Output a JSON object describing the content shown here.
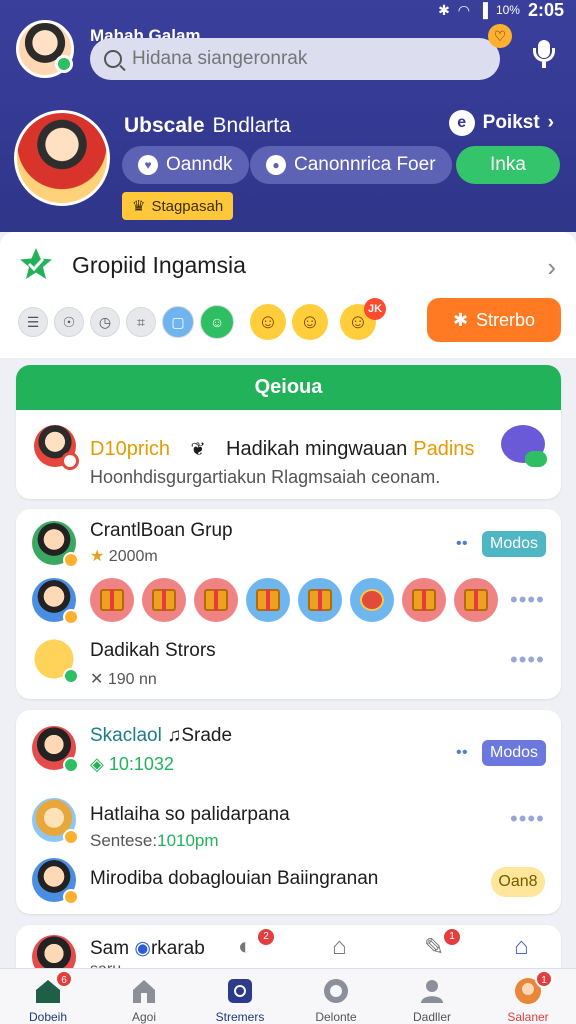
{
  "status_bar": {
    "icons": [
      "bluetooth-icon",
      "wifi-icon",
      "signal-icon"
    ],
    "battery": "10%",
    "time": "2:05"
  },
  "header": {
    "app_name": "Mahah Galam",
    "search_placeholder": "Hidana siangeronrak"
  },
  "profile": {
    "name_first": "Ubscale",
    "name_second": "Bndlarta",
    "points_label": "Poikst",
    "pill_1": "Oanndk",
    "pill_2": "Canonnrica Foer",
    "pill_3": "Inka",
    "level_tag": "Stagpasah"
  },
  "group": {
    "title": "Gropiid Ingamsia",
    "smiley_badge": "JK",
    "action_button": "Strerbo"
  },
  "news": {
    "header": "Qeioua",
    "line_prefix": "D10prich",
    "line_main": "Hadikah mingwauan",
    "line_highlight": "Padins",
    "subtitle": "Hoonhdisgurgartiakun Rlagmsaiah ceonam."
  },
  "feed1": {
    "title": "CrantlBoan Grup",
    "sub": "2000m",
    "mode_label": "Modos",
    "row2_title": "Dadikah Strors",
    "row2_sub": "190 nn"
  },
  "feed2": {
    "title": "Skaclaol",
    "title_suffix": "Srade",
    "sub": "10:1032",
    "mode_label": "Modos",
    "row2_title": "Hatlaiha so palidarpana",
    "row2_sub_prefix": "Sentese:",
    "row2_sub_value": "1010pm",
    "row3_title": "Mirodiba dobaglouian Baiingranan",
    "row3_tag": "Oan8"
  },
  "feed3": {
    "title": "Sam",
    "title_suffix": "rkarab",
    "second_line": "saru",
    "badge_1": "2",
    "badge_2": "1"
  },
  "nav": {
    "items": [
      {
        "label": "Dobeih",
        "icon": "home-icon",
        "badge": "6"
      },
      {
        "label": "Agoi",
        "icon": "house-outline-icon",
        "badge": ""
      },
      {
        "label": "Stremers",
        "icon": "stream-icon",
        "badge": ""
      },
      {
        "label": "Delonte",
        "icon": "circle-icon",
        "badge": ""
      },
      {
        "label": "Dadller",
        "icon": "profile-icon",
        "badge": ""
      },
      {
        "label": "Salaner",
        "icon": "avatar-icon",
        "badge": "1"
      }
    ]
  },
  "colors": {
    "header_bg": "#343a92",
    "accent_green": "#22b35a",
    "accent_orange": "#ff7a22",
    "accent_yellow": "#ffc83a"
  }
}
